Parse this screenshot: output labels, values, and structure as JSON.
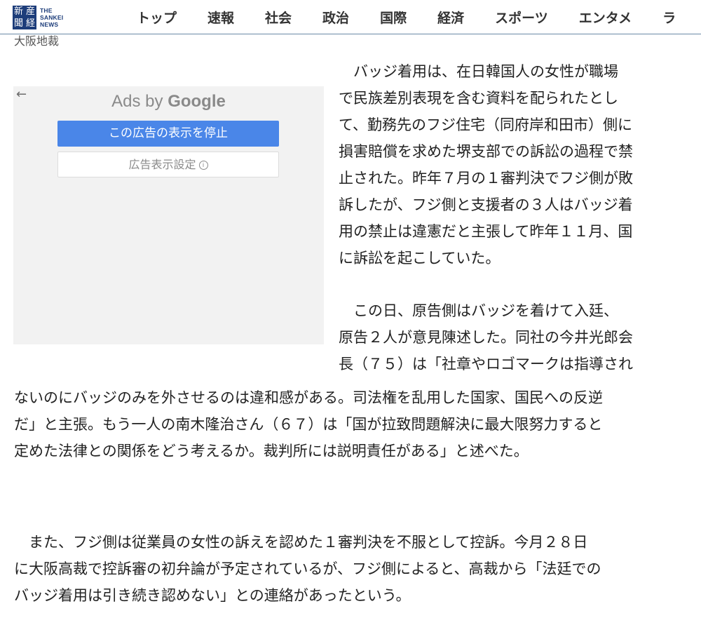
{
  "header": {
    "logo": {
      "mark_chars": [
        "産",
        "新",
        "経",
        "聞"
      ],
      "text_lines": [
        "THE",
        "SANKEI",
        "NEWS"
      ]
    },
    "nav": [
      "トップ",
      "速報",
      "社会",
      "政治",
      "国際",
      "経済",
      "スポーツ",
      "エンタメ",
      "ラ"
    ]
  },
  "dateline": "大阪地裁",
  "ad": {
    "title_prefix": "Ads by",
    "title_brand": "Google",
    "stop_button": "この広告の表示を停止",
    "settings_button": "広告表示設定",
    "info_glyph": "i"
  },
  "article": {
    "paragraph1_lines": [
      "　バッジ着用は、在日韓国人の女性が職場",
      "で民族差別表現を含む資料を配られたとし",
      "て、勤務先のフジ住宅（同府岸和田市）側に",
      "損害賠償を求めた堺支部での訴訟の過程で禁",
      "止された。昨年７月の１審判決でフジ側が敗",
      "訴したが、フジ側と支援者の３人はバッジ着",
      "用の禁止は違憲だと主張して昨年１１月、国",
      "に訴訟を起こしていた。"
    ],
    "paragraph2_narrow_lines": [
      "　この日、原告側はバッジを着けて入廷、",
      "原告２人が意見陳述した。同社の今井光郎会",
      "長（７５）は「社章やロゴマークは指導され"
    ],
    "paragraph2_wide_lines": [
      "ないのにバッジのみを外させるのは違和感がある。司法権を乱用した国家、国民への反逆",
      "だ」と主張。もう一人の南木隆治さん（６７）は「国が拉致問題解決に最大限努力すると",
      "定めた法律との関係をどう考えるか。裁判所には説明責任がある」と述べた。"
    ],
    "paragraph3_lines": [
      "　また、フジ側は従業員の女性の訴えを認めた１審判決を不服として控訴。今月２８日",
      "に大阪高裁で控訴審の初弁論が予定されているが、フジ側によると、高裁から「法廷での",
      "バッジ着用は引き続き認めない」との連絡があったという。"
    ]
  },
  "colors": {
    "brand_navy": "#1d3d7a",
    "ad_button_blue": "#4a86e8",
    "ad_background": "#f2f2f2"
  }
}
